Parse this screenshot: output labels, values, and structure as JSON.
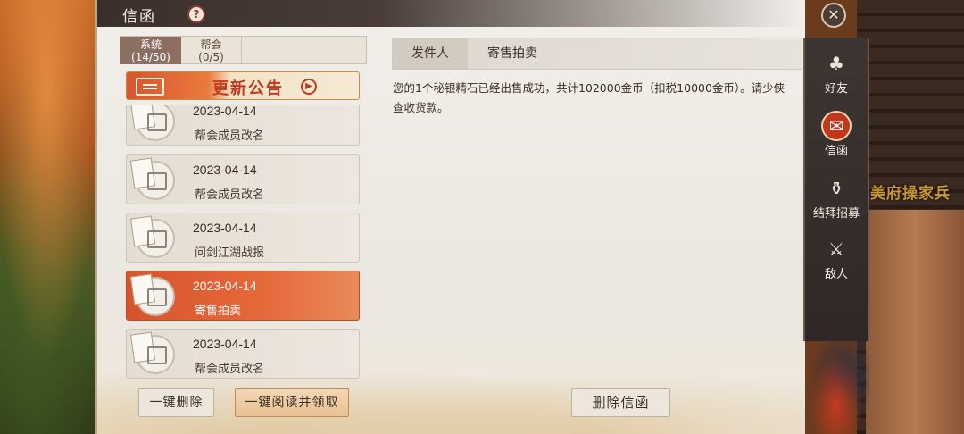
{
  "window": {
    "title": "信函",
    "help_icon": "?",
    "close_icon": "✕"
  },
  "background": {
    "sign_text": "美府操家兵"
  },
  "tabs": [
    {
      "label": "系统",
      "count": "(14/50)"
    },
    {
      "label": "帮会",
      "count": "(0/5)"
    }
  ],
  "announcement": {
    "label": "更新公告"
  },
  "mails": [
    {
      "date": "2023-04-14",
      "title": "帮会成员改名",
      "selected": false
    },
    {
      "date": "2023-04-14",
      "title": "帮会成员改名",
      "selected": false
    },
    {
      "date": "2023-04-14",
      "title": "问剑江湖战报",
      "selected": false
    },
    {
      "date": "2023-04-14",
      "title": "寄售拍卖",
      "selected": true
    },
    {
      "date": "2023-04-14",
      "title": "帮会成员改名",
      "selected": false
    }
  ],
  "buttons": {
    "delete_all": "一键删除",
    "read_all": "一键阅读并领取",
    "delete_mail": "删除信函"
  },
  "detail": {
    "sender_label": "发件人",
    "sender_name": "寄售拍卖",
    "body": "您的1个秘银精石已经出售成功，共计102000金币（扣税10000金币）。请少侠查收货款。"
  },
  "side_nav": [
    {
      "label": "好友",
      "icon": "friends-icon",
      "active": false
    },
    {
      "label": "信函",
      "icon": "letter-icon",
      "active": true
    },
    {
      "label": "结拜招募",
      "icon": "sworn-brother-icon",
      "active": false
    },
    {
      "label": "敌人",
      "icon": "enemy-icon",
      "active": false
    }
  ]
}
